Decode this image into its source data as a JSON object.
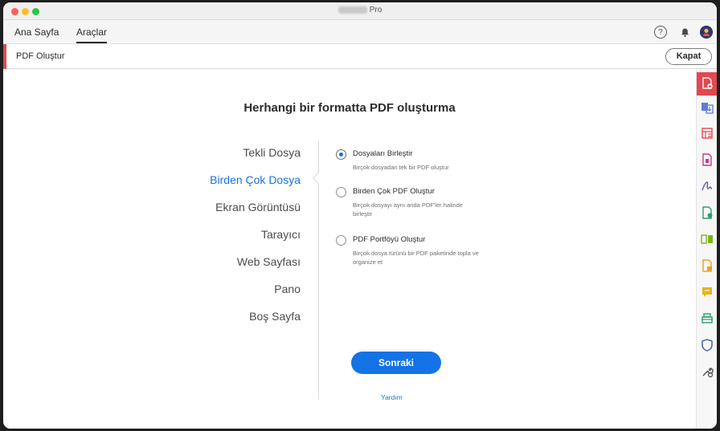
{
  "window": {
    "title": "Pro"
  },
  "tabs": {
    "home": "Ana Sayfa",
    "tools": "Araçlar"
  },
  "header_icons": {
    "help": "help-icon",
    "bell": "bell-icon",
    "avatar": "avatar-icon",
    "help_glyph": "?"
  },
  "toolbar": {
    "title": "PDF Oluştur",
    "close_label": "Kapat"
  },
  "main": {
    "heading": "Herhangi bir formatta PDF oluşturma",
    "nav": [
      {
        "label": "Tekli Dosya",
        "active": false
      },
      {
        "label": "Birden Çok Dosya",
        "active": true
      },
      {
        "label": "Ekran Görüntüsü",
        "active": false
      },
      {
        "label": "Tarayıcı",
        "active": false
      },
      {
        "label": "Web Sayfası",
        "active": false
      },
      {
        "label": "Pano",
        "active": false
      },
      {
        "label": "Boş Sayfa",
        "active": false
      }
    ],
    "options": [
      {
        "title": "Dosyaları Birleştir",
        "desc": "Birçok dosyadan tek bir PDF oluştur",
        "selected": true
      },
      {
        "title": "Birden Çok PDF Oluştur",
        "desc": "Birçok dosyayı aynı anda PDF'ler halinde birleştir",
        "selected": false
      },
      {
        "title": "PDF Portföyü Oluştur",
        "desc": "Birçok dosya türünü bir PDF paketinde topla ve organize et",
        "selected": false
      }
    ],
    "next_label": "Sonraki",
    "help_label": "Yardım"
  },
  "colors": {
    "accent": "#1473e6",
    "tool_red": "#e34850"
  },
  "right_tools": [
    "create-pdf-icon",
    "export-pdf-icon",
    "organize-pages-icon",
    "compress-pdf-icon",
    "fill-sign-icon",
    "edit-pdf-icon",
    "combine-files-icon",
    "request-signature-icon",
    "comment-icon",
    "scan-icon",
    "protect-icon",
    "more-tools-icon"
  ]
}
